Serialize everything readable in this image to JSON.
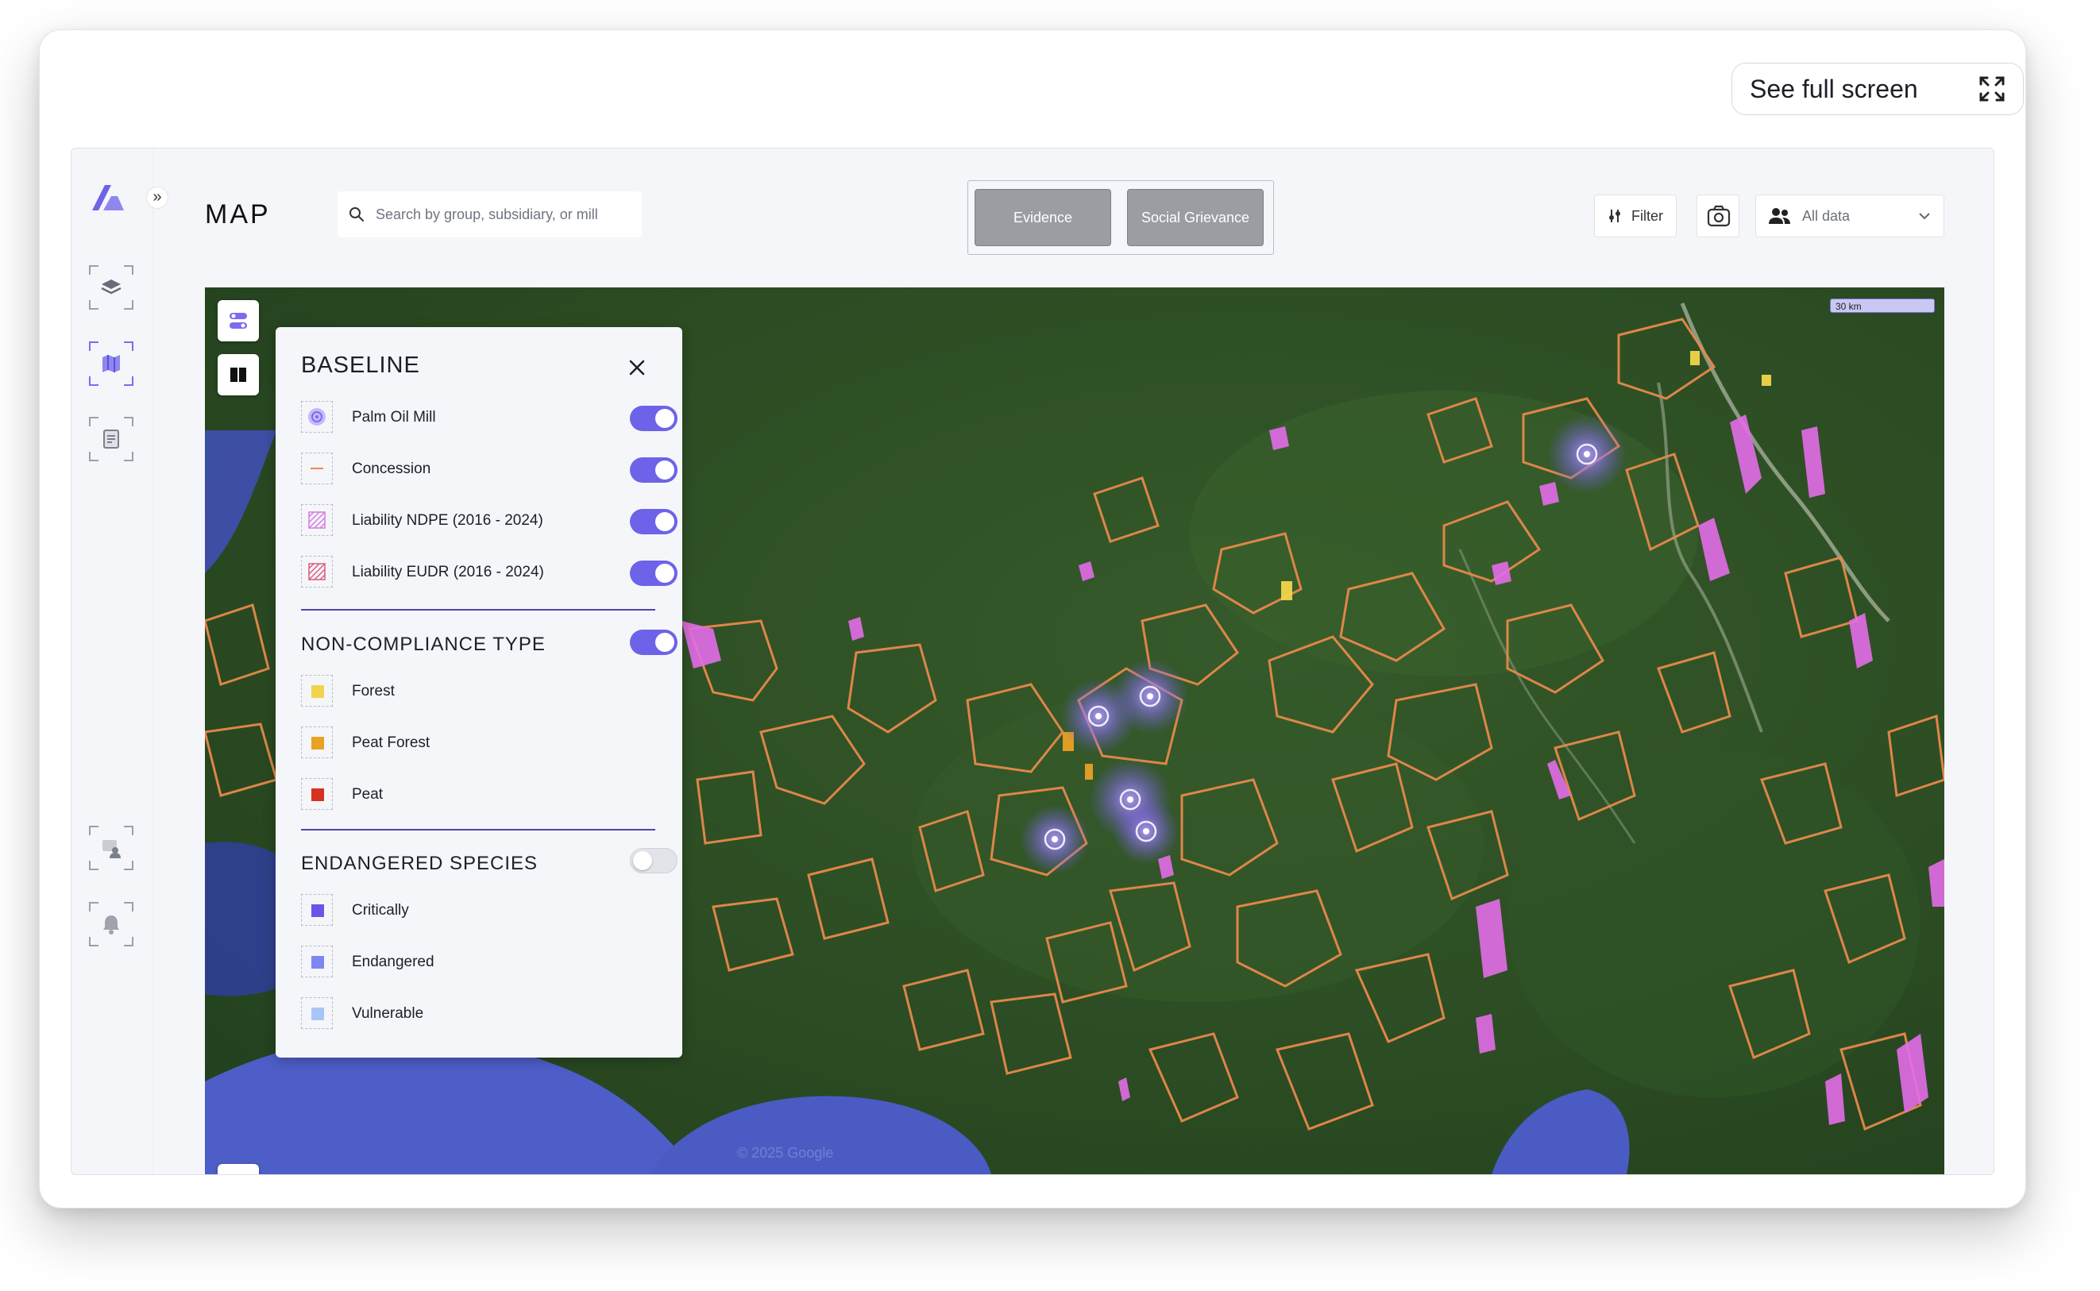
{
  "window": {
    "fullscreen_label": "See full screen"
  },
  "header": {
    "page_title": "MAP",
    "search_placeholder": "Search by group, subsidiary, or mill",
    "view_toggle": [
      "Evidence",
      "Social Grievance"
    ],
    "filter_label": "Filter",
    "data_select": "All data"
  },
  "sidebar": {
    "items": [
      "layers-icon",
      "map-icon",
      "document-icon",
      "group-icon",
      "bell-icon"
    ]
  },
  "map": {
    "scale_label": "30 km",
    "attribution": "© 2025 Google"
  },
  "legend": {
    "baseline": {
      "title": "BASELINE",
      "items": [
        {
          "label": "Palm Oil Mill",
          "enabled": true
        },
        {
          "label": "Concession",
          "enabled": true
        },
        {
          "label": "Liability NDPE (2016 - 2024)",
          "enabled": true
        },
        {
          "label": "Liability EUDR (2016 - 2024)",
          "enabled": true
        }
      ]
    },
    "noncompliance": {
      "title": "NON-COMPLIANCE TYPE",
      "enabled": true,
      "items": [
        {
          "label": "Forest",
          "color": "#f0d54c"
        },
        {
          "label": "Peat Forest",
          "color": "#e9a126"
        },
        {
          "label": "Peat",
          "color": "#d7321f"
        }
      ]
    },
    "species": {
      "title": "ENDANGERED SPECIES",
      "enabled": false,
      "items": [
        {
          "label": "Critically",
          "color": "#6c55e6"
        },
        {
          "label": "Endangered",
          "color": "#7f86f2"
        },
        {
          "label": "Vulnerable",
          "color": "#a9c5f7"
        }
      ]
    }
  },
  "colors": {
    "accent": "#6d63e8",
    "concession": "#e8894a",
    "liability": "#e36de8"
  }
}
